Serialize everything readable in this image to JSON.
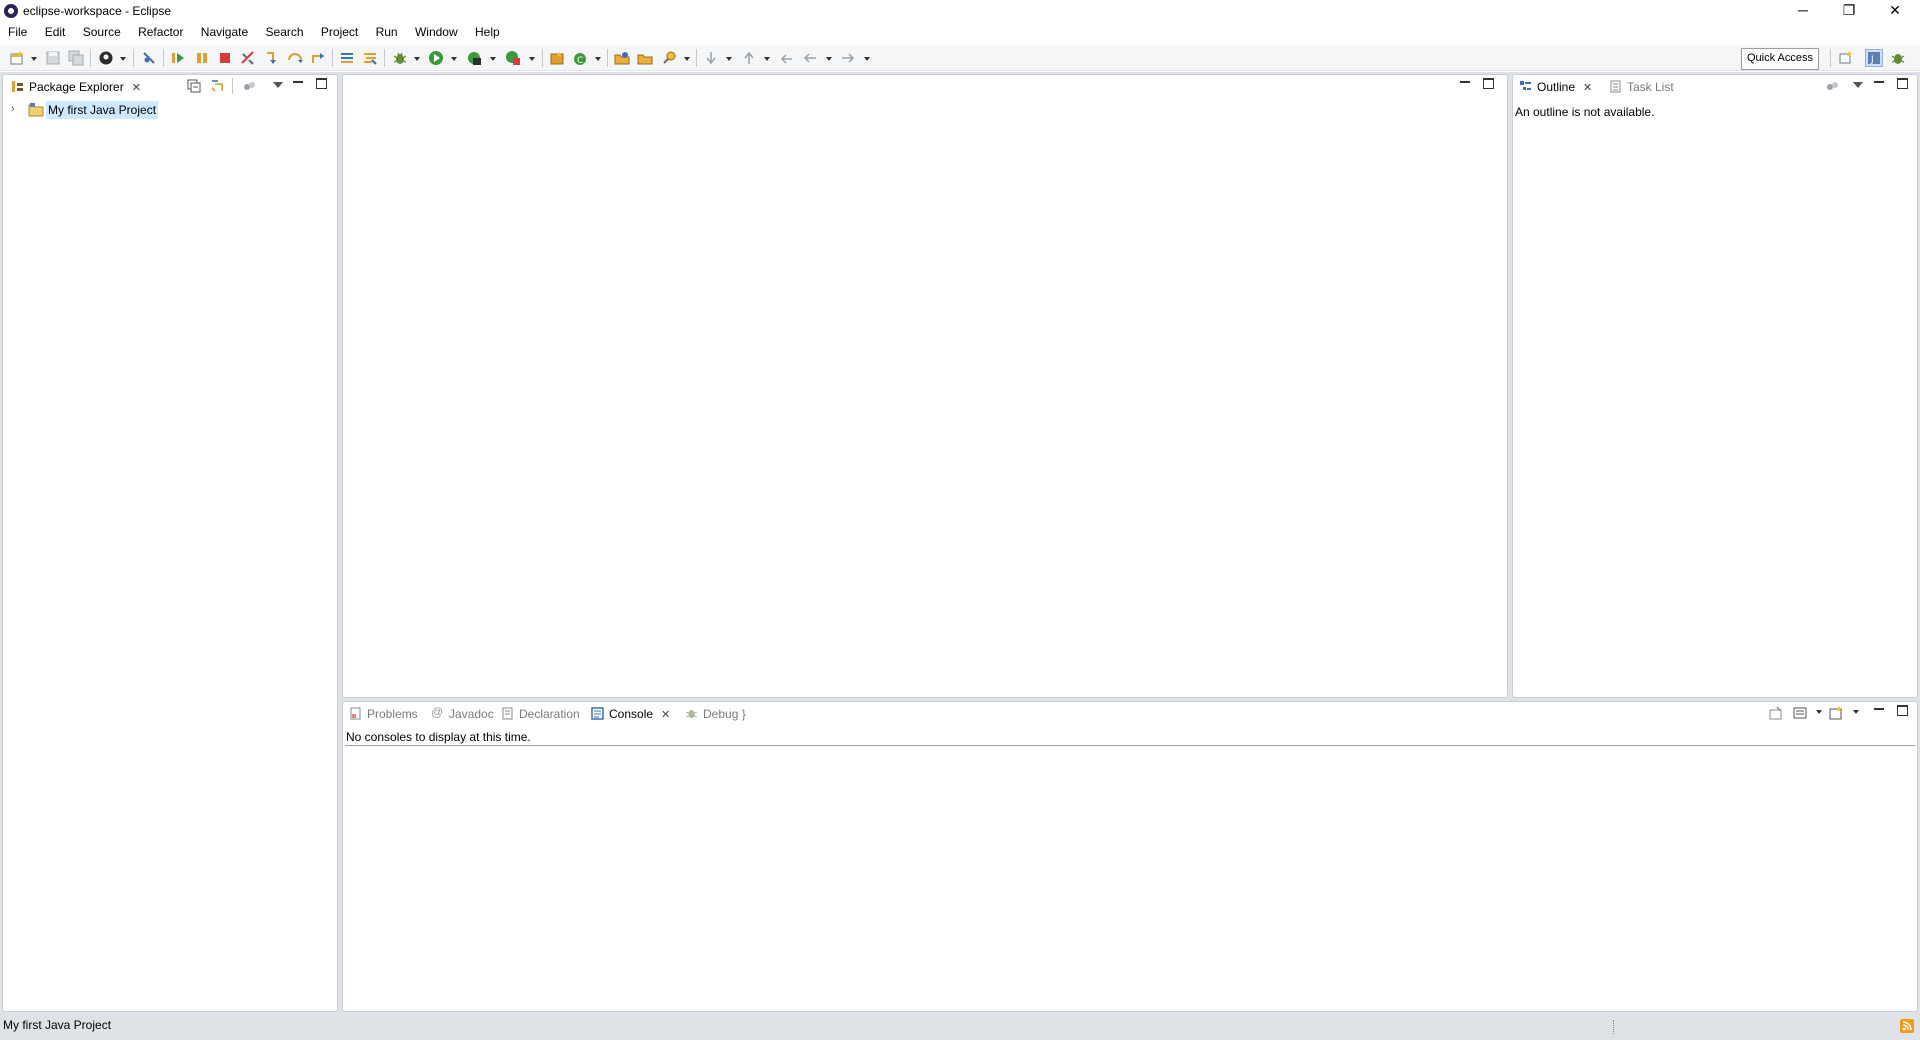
{
  "window": {
    "title": "eclipse-workspace - Eclipse",
    "minimize_glyph": "─",
    "restore_glyph": "❐",
    "close_glyph": "✕"
  },
  "menubar": {
    "items": [
      "File",
      "Edit",
      "Source",
      "Refactor",
      "Navigate",
      "Search",
      "Project",
      "Run",
      "Window",
      "Help"
    ]
  },
  "toolbar": {
    "quick_access": "Quick Access"
  },
  "package_explorer": {
    "tab_label": "Package Explorer",
    "tree": [
      {
        "label": "My first Java Project",
        "expanded": false,
        "selected": true
      }
    ]
  },
  "outline": {
    "tabs": [
      {
        "label": "Outline",
        "active": true
      },
      {
        "label": "Task List",
        "active": false
      }
    ],
    "message": "An outline is not available."
  },
  "bottom_panel": {
    "tabs": [
      {
        "label": "Problems",
        "active": false
      },
      {
        "label": "Javadoc",
        "active": false
      },
      {
        "label": "Declaration",
        "active": false
      },
      {
        "label": "Console",
        "active": true
      },
      {
        "label": "Debug",
        "active": false
      }
    ],
    "message": "No consoles to display at this time."
  },
  "statusbar": {
    "text": "My first Java Project"
  },
  "colors": {
    "workbench_bg": "#dfe3e8",
    "selection_bg": "#cde8ff",
    "accent_blue": "#3b6fb6",
    "run_green": "#3c9a3c",
    "stop_red": "#d83b3b",
    "debug_bug": "#5e8f34"
  }
}
